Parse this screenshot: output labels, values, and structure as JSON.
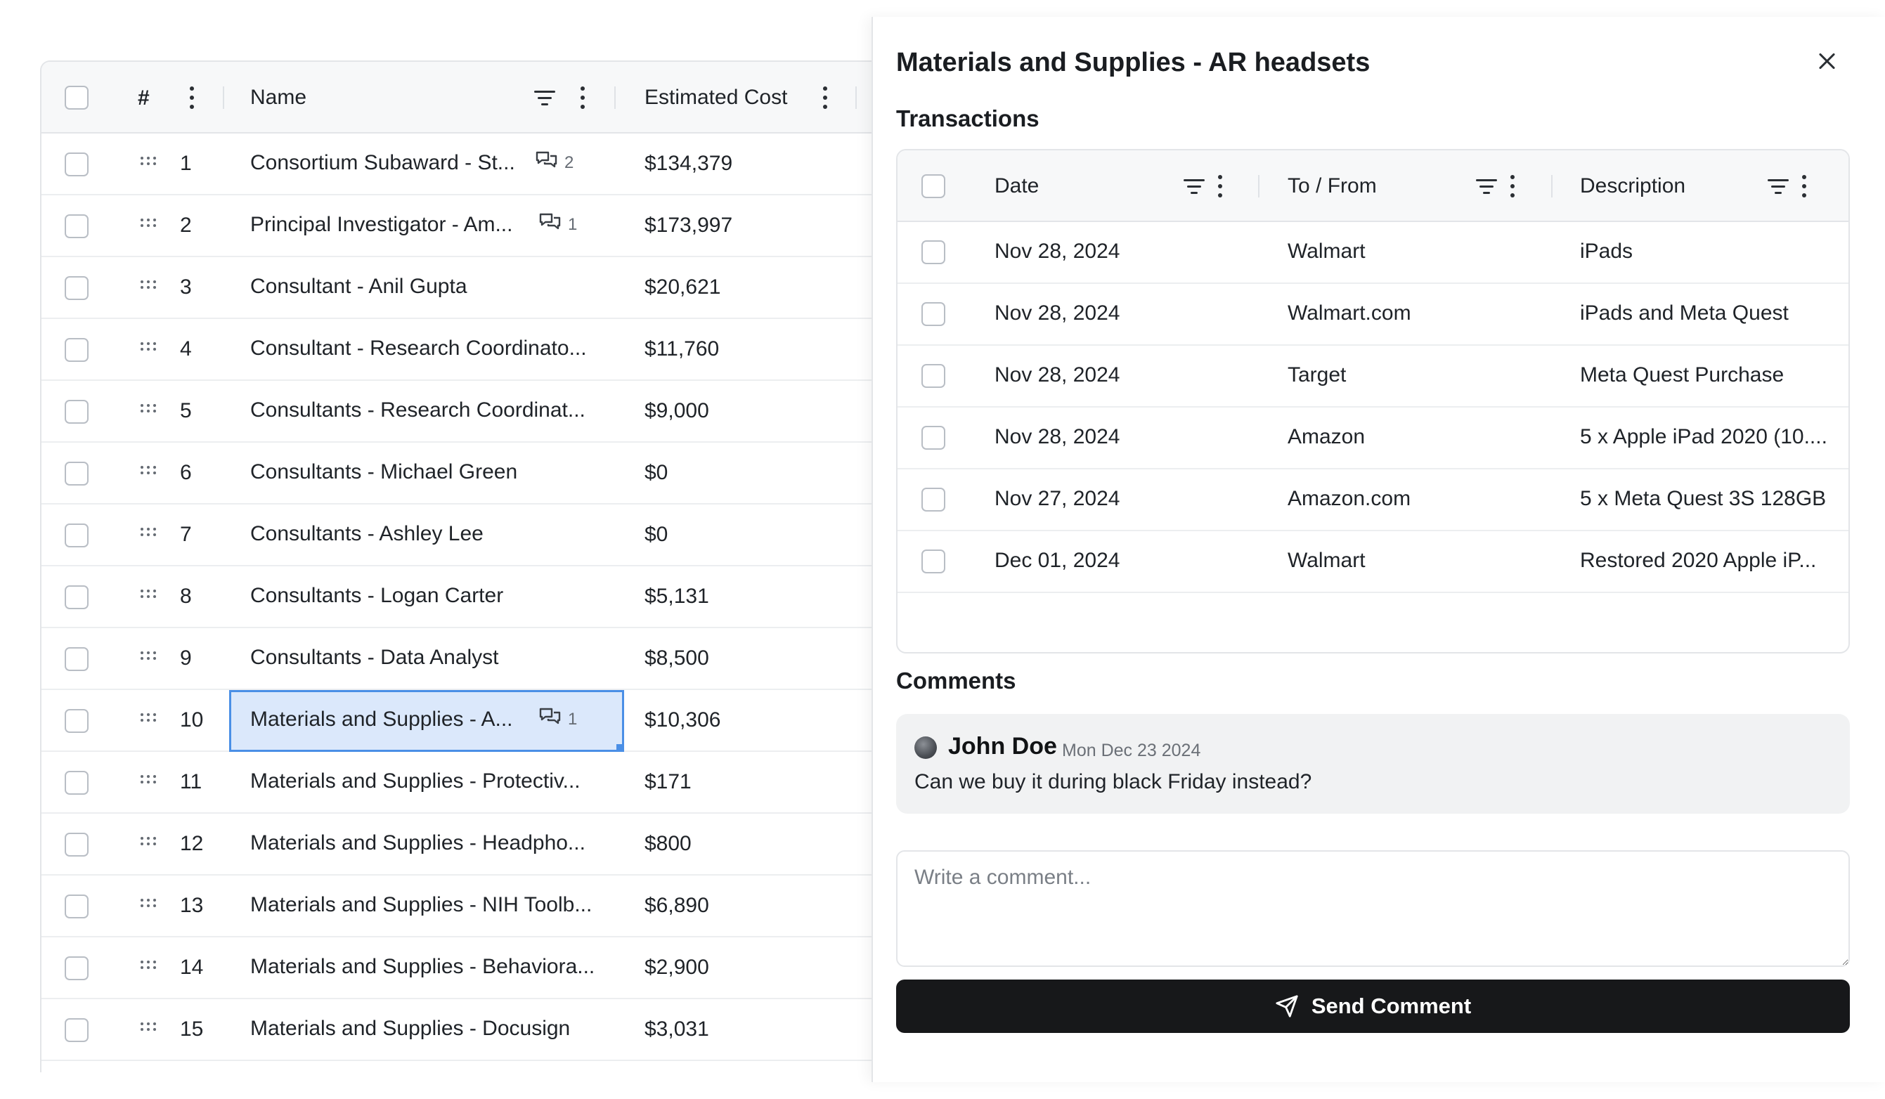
{
  "budget_table": {
    "headers": {
      "index": "#",
      "name": "Name",
      "estimated_cost": "Estimated Cost"
    },
    "rows": [
      {
        "num": "1",
        "name": "Consortium Subaward - St...",
        "cost": "$134,379",
        "comments": "2"
      },
      {
        "num": "2",
        "name": "Principal Investigator - Am...",
        "cost": "$173,997",
        "comments": "1"
      },
      {
        "num": "3",
        "name": "Consultant - Anil Gupta",
        "cost": "$20,621",
        "comments": ""
      },
      {
        "num": "4",
        "name": "Consultant - Research Coordinato...",
        "cost": "$11,760",
        "comments": ""
      },
      {
        "num": "5",
        "name": "Consultants - Research Coordinat...",
        "cost": "$9,000",
        "comments": ""
      },
      {
        "num": "6",
        "name": "Consultants - Michael Green",
        "cost": "$0",
        "comments": ""
      },
      {
        "num": "7",
        "name": "Consultants - Ashley Lee",
        "cost": "$0",
        "comments": ""
      },
      {
        "num": "8",
        "name": "Consultants - Logan Carter",
        "cost": "$5,131",
        "comments": ""
      },
      {
        "num": "9",
        "name": "Consultants - Data Analyst",
        "cost": "$8,500",
        "comments": ""
      },
      {
        "num": "10",
        "name": "Materials and Supplies - A...",
        "cost": "$10,306",
        "comments": "1",
        "selected": true
      },
      {
        "num": "11",
        "name": "Materials and Supplies - Protectiv...",
        "cost": "$171",
        "comments": ""
      },
      {
        "num": "12",
        "name": "Materials and Supplies - Headpho...",
        "cost": "$800",
        "comments": ""
      },
      {
        "num": "13",
        "name": "Materials and Supplies - NIH Toolb...",
        "cost": "$6,890",
        "comments": ""
      },
      {
        "num": "14",
        "name": "Materials and Supplies - Behaviora...",
        "cost": "$2,900",
        "comments": ""
      },
      {
        "num": "15",
        "name": "Materials and Supplies - Docusign",
        "cost": "$3,031",
        "comments": ""
      }
    ]
  },
  "panel": {
    "title": "Materials and Supplies - AR headsets",
    "transactions_title": "Transactions",
    "transactions": {
      "headers": {
        "date": "Date",
        "to_from": "To / From",
        "description": "Description"
      },
      "rows": [
        {
          "date": "Nov 28, 2024",
          "to_from": "Walmart",
          "description": "iPads"
        },
        {
          "date": "Nov 28, 2024",
          "to_from": "Walmart.com",
          "description": "iPads and Meta Quest"
        },
        {
          "date": "Nov 28, 2024",
          "to_from": "Target",
          "description": "Meta Quest Purchase"
        },
        {
          "date": "Nov 28, 2024",
          "to_from": "Amazon",
          "description": "5 x Apple iPad 2020 (10...."
        },
        {
          "date": "Nov 27, 2024",
          "to_from": "Amazon.com",
          "description": "5 x Meta Quest 3S 128GB"
        },
        {
          "date": "Dec 01, 2024",
          "to_from": "Walmart",
          "description": "Restored 2020 Apple iP..."
        }
      ]
    },
    "comments_title": "Comments",
    "comments": [
      {
        "author": "John Doe",
        "date": "Mon Dec 23 2024",
        "text": "Can we buy it during black Friday instead?"
      }
    ],
    "comment_placeholder": "Write a comment...",
    "send_label": "Send Comment"
  },
  "icons": {
    "close": "close-icon",
    "filter": "filter-icon",
    "more": "more-vertical-icon",
    "drag": "drag-handle-icon",
    "comment": "comment-icon",
    "send": "send-icon"
  },
  "colors": {
    "selection_fill": "#dbe8fb",
    "selection_border": "#4a8fe6",
    "button_bg": "#17181a"
  }
}
